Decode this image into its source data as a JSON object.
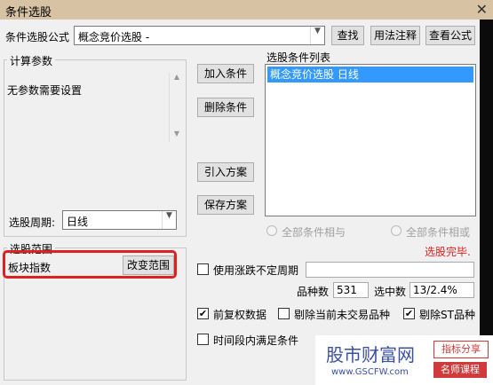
{
  "title": "条件选股",
  "formula": {
    "label": "条件选股公式",
    "value": "概念竞价选股  -",
    "btn_find": "查找",
    "btn_help": "用法注释",
    "btn_view": "查看公式"
  },
  "params": {
    "group_title": "计算参数",
    "text": "无参数需要设置"
  },
  "period": {
    "label": "选股周期:",
    "value": "日线"
  },
  "range": {
    "group_title": "选股范围",
    "value": "板块指数",
    "btn_change": "改变范围"
  },
  "buttons": {
    "add": "加入条件",
    "delete": "删除条件",
    "import": "引入方案",
    "save": "保存方案"
  },
  "conditions": {
    "label": "选股条件列表",
    "items": [
      "概念竞价选股  日线"
    ]
  },
  "logic": {
    "and_label": "全部条件相与",
    "or_label": "全部条件相或"
  },
  "status": "选股完毕.",
  "uncertain": {
    "label": "使用涨跌不定周期"
  },
  "stats": {
    "count_label": "品种数",
    "count_value": "531",
    "selected_label": "选中数",
    "selected_value": "13/2.4%"
  },
  "options": {
    "fq": "前复权数据",
    "exclude_untraded": "剔除当前未交易品种",
    "exclude_st": "剔除ST品种",
    "time_range": "时间段内满足条件"
  },
  "watermark": {
    "site": "股市财富网",
    "url": "www.GSCFW.com",
    "tag1": "指标分享",
    "tag2": "名师课程"
  },
  "colors": {
    "selection": "#3399ff",
    "status_red": "#e02020",
    "titlebar": "#d7c3a4",
    "watermark_blue": "#3a4fa0"
  }
}
